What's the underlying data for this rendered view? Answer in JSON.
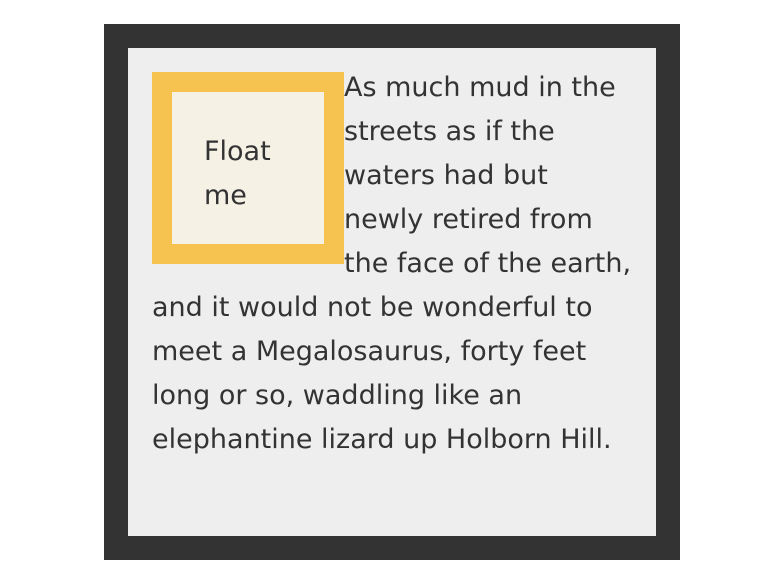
{
  "float_box": {
    "label": "Float me",
    "border_color": "#f6c351",
    "background_color": "#f6f1e5"
  },
  "paragraph": {
    "text": "As much mud in the streets as if the waters had but newly retired from the face of the earth, and it would not be wonderful to meet a Megalosaurus, forty feet long or so, waddling like an elephantine lizard up Holborn Hill."
  },
  "colors": {
    "outer_frame": "#333333",
    "panel": "#eeeeee",
    "text": "#333333"
  }
}
